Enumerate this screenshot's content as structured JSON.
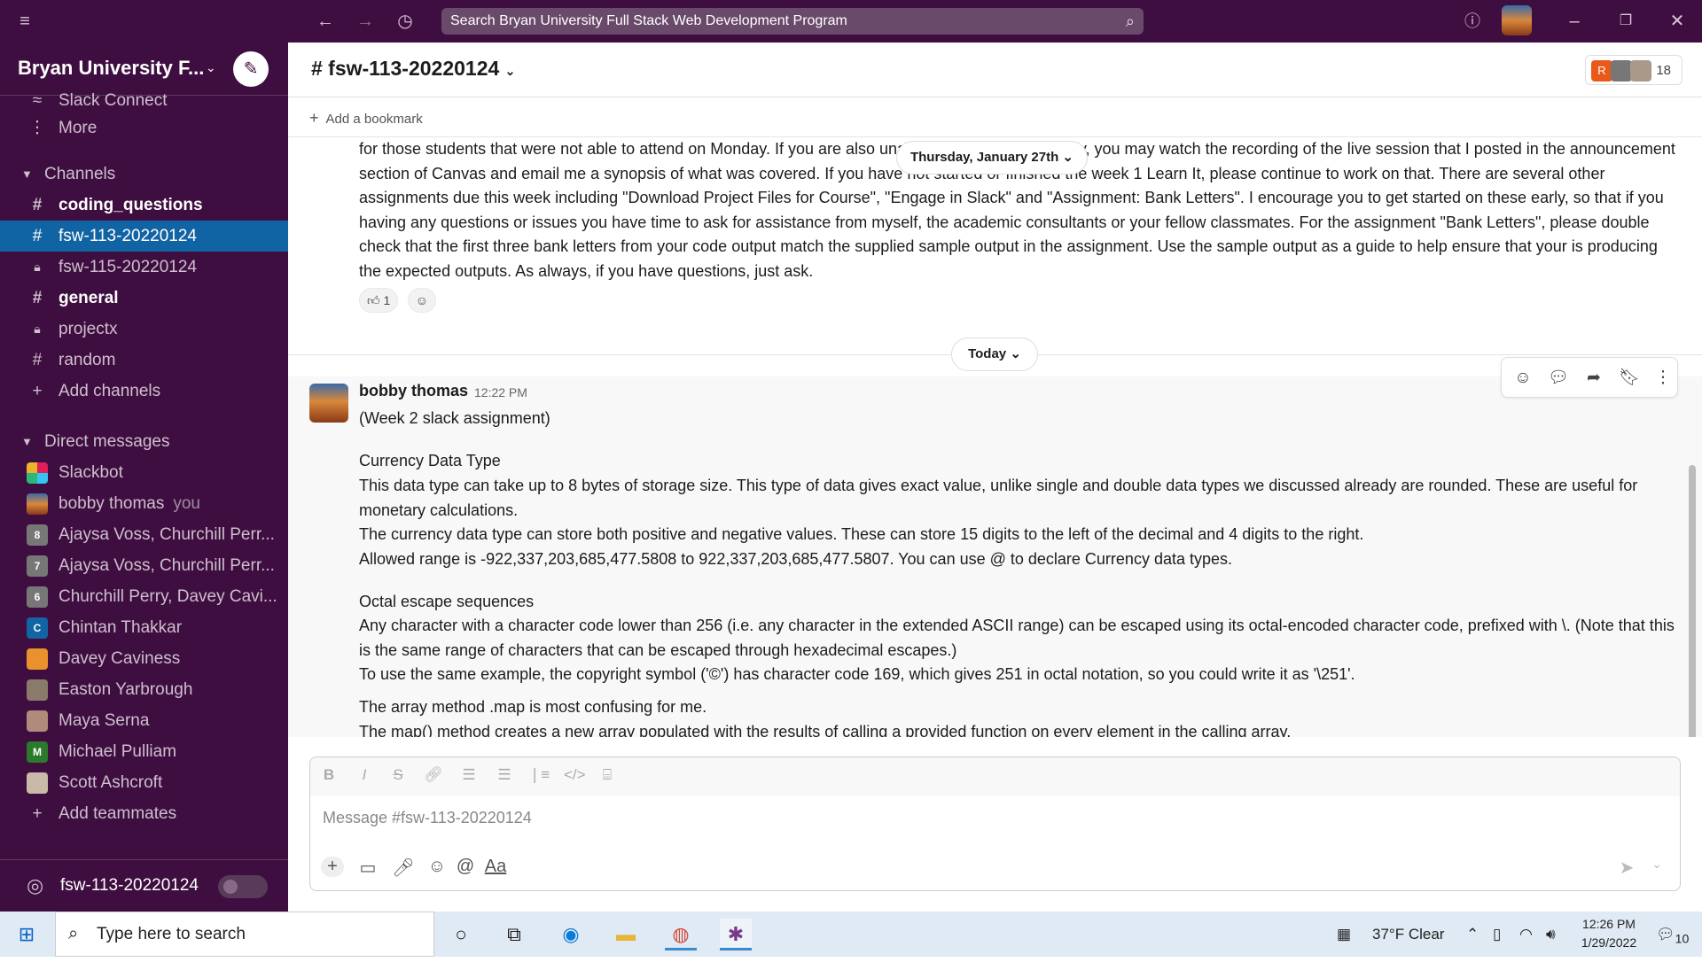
{
  "search": {
    "placeholder": "Search Bryan University Full Stack Web Development Program"
  },
  "workspace": {
    "name": "Bryan University F..."
  },
  "sidebar": {
    "partial_top": "Slack Connect",
    "more": "More",
    "channels_header": "Channels",
    "channels": [
      {
        "name": "coding_questions",
        "prefix": "#",
        "bold": true
      },
      {
        "name": "fsw-113-20220124",
        "prefix": "#",
        "active": true
      },
      {
        "name": "fsw-115-20220124",
        "prefix": "lock"
      },
      {
        "name": "general",
        "prefix": "#",
        "bold": true
      },
      {
        "name": "projectx",
        "prefix": "lock"
      },
      {
        "name": "random",
        "prefix": "#"
      }
    ],
    "add_channels": "Add channels",
    "dm_header": "Direct messages",
    "dms": [
      {
        "name": "Slackbot"
      },
      {
        "name": "bobby thomas",
        "suffix": "you"
      },
      {
        "name": "Ajaysa Voss, Churchill Perr...",
        "count": "8"
      },
      {
        "name": "Ajaysa Voss, Churchill Perr...",
        "count": "7"
      },
      {
        "name": "Churchill Perry, Davey Cavi...",
        "count": "6"
      },
      {
        "name": "Chintan Thakkar",
        "initial": "C"
      },
      {
        "name": "Davey Caviness"
      },
      {
        "name": "Easton Yarbrough"
      },
      {
        "name": "Maya Serna"
      },
      {
        "name": "Michael Pulliam",
        "initial": "M"
      },
      {
        "name": "Scott Ashcroft"
      }
    ],
    "add_teammates": "Add teammates",
    "huddle_channel": "fsw-113-20220124"
  },
  "channel": {
    "title": "# fsw-113-20220124",
    "member_count": "18",
    "member_initial": "R",
    "bookmark": "Add a bookmark"
  },
  "messages": {
    "old_text": "for those students that were not able to attend on Monday.  If you are also unable to attend on Thursday, you may watch the recording of the live session that I posted in the announcement section of Canvas and email me a synopsis of what was covered.  If you have not started or finished the week 1 Learn It, please continue to work on that.  There are several other assignments due this week including \"Download Project Files for Course\", \"Engage in Slack\" and \"Assignment: Bank Letters\".  I encourage you to get started on these early, so that if you having any questions or issues you have time to ask for assistance from myself, the academic consultants or your fellow classmates.  For the assignment \"Bank Letters\", please double check that the first three bank letters from your code output match the supplied sample output in the assignment.  Use the sample output as a guide to help ensure that your is producing the expected outputs.  As always, if you have questions, just ask.",
    "date_old": "Thursday, January 27th",
    "reaction_count": "1",
    "date_today": "Today",
    "author": "bobby thomas",
    "time": "12:22 PM",
    "lines": [
      "(Week 2 slack assignment)",
      "Currency Data Type",
      "This data type can take up to 8 bytes of storage size. This type of data gives exact value, unlike single and double data types we discussed already are rounded. These are useful for monetary calculations.",
      "The currency data type can store both positive and negative values. These can store 15 digits to the left of the decimal and 4 digits to the right.",
      "Allowed range is -922,337,203,685,477.5808 to 922,337,203,685,477.5807. You can use @ to declare Currency data types.",
      "Octal escape sequences",
      "Any character with a character code lower than 256 (i.e. any character in the extended ASCII range) can be escaped using its octal-encoded character code, prefixed with \\. (Note that this is the same range of characters that can be escaped through hexadecimal escapes.)",
      "To use the same example, the copyright symbol ('©') has character code 169, which gives 251 in octal notation, so you could write it as '\\251'.",
      "The array method .map is most confusing for me.",
      "The map() method creates a new array populated with the results of calling a provided function on every element in the calling array."
    ]
  },
  "composer": {
    "placeholder": "Message #fsw-113-20220124"
  },
  "taskbar": {
    "search": "Type here to search",
    "weather": "37°F  Clear",
    "time": "12:26 PM",
    "date": "1/29/2022",
    "notif": "10"
  },
  "colors": {
    "aubergine": "#3f0e40",
    "active": "#1164a3"
  }
}
